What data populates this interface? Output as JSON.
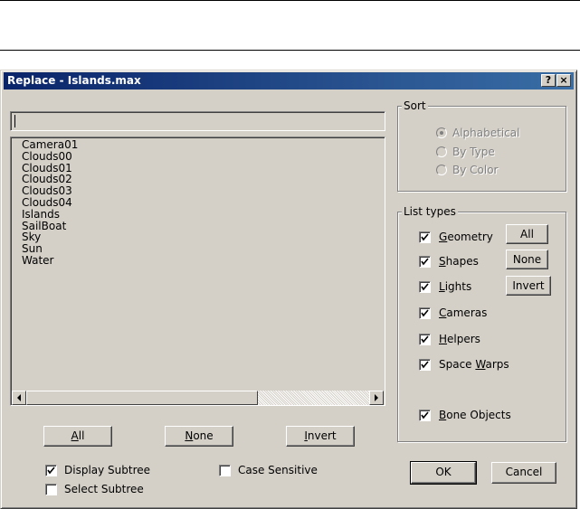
{
  "window": {
    "title": "Replace - Islands.max",
    "help_label": "?",
    "close_label": "×"
  },
  "filter_input": {
    "value": ""
  },
  "object_list": {
    "items": [
      "Camera01",
      "Clouds00",
      "Clouds01",
      "Clouds02",
      "Clouds03",
      "Clouds04",
      "Islands",
      "SailBoat",
      "Sky",
      "Sun",
      "Water"
    ]
  },
  "list_buttons": {
    "all": {
      "mnemonic": "A",
      "rest": "ll"
    },
    "none": {
      "mnemonic": "N",
      "rest": "one"
    },
    "invert": {
      "mnemonic": "I",
      "rest": "nvert"
    }
  },
  "options": {
    "display_subtree": {
      "label": "Display Subtree",
      "checked": true
    },
    "case_sensitive": {
      "label": "Case Sensitive",
      "checked": false
    },
    "select_subtree": {
      "label": "Select Subtree",
      "checked": false
    }
  },
  "sort": {
    "legend": "Sort",
    "alphabetical": {
      "label": "Alphabetical",
      "selected": true
    },
    "by_type": {
      "label": "By Type",
      "selected": false
    },
    "by_color": {
      "label": "By Color",
      "selected": false
    }
  },
  "list_types": {
    "legend": "List types",
    "geometry": {
      "mnemonic": "G",
      "rest": "eometry",
      "checked": true
    },
    "shapes": {
      "mnemonic": "S",
      "rest": "hapes",
      "checked": true
    },
    "lights": {
      "mnemonic": "L",
      "rest": "ights",
      "checked": true
    },
    "cameras": {
      "mnemonic": "C",
      "rest": "ameras",
      "checked": true
    },
    "helpers": {
      "mnemonic": "H",
      "rest": "elpers",
      "checked": true
    },
    "space_warps": {
      "pre": "Space ",
      "mnemonic": "W",
      "rest": "arps",
      "checked": true
    },
    "bone_objects": {
      "mnemonic": "B",
      "rest": "one Objects",
      "checked": true
    },
    "all_label": "All",
    "none_label": "None",
    "invert_label": "Invert"
  },
  "dialog_buttons": {
    "ok": "OK",
    "cancel": "Cancel"
  }
}
